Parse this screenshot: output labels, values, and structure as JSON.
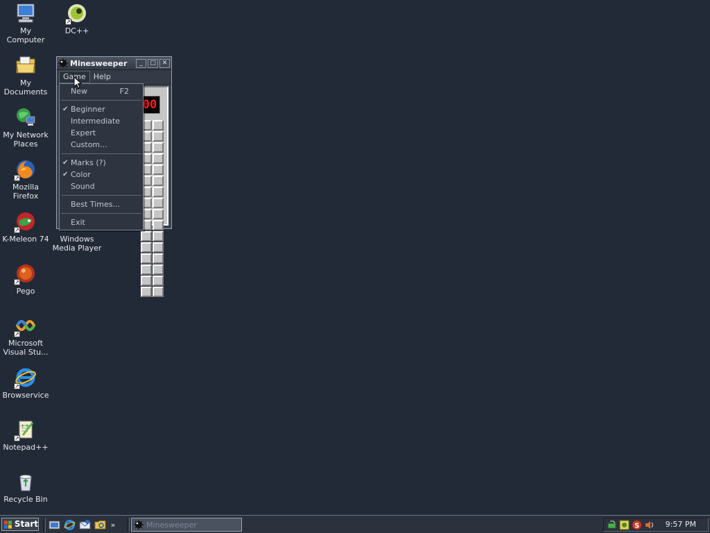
{
  "desktop": {
    "icons": [
      {
        "label": "My Computer",
        "icon": "my-computer-icon"
      },
      {
        "label": "My Documents",
        "icon": "my-documents-icon"
      },
      {
        "label": "My Network Places",
        "icon": "network-places-icon"
      },
      {
        "label": "Mozilla Firefox",
        "icon": "firefox-icon"
      },
      {
        "label": "K-Meleon 74",
        "icon": "k-meleon-icon"
      },
      {
        "label": "Pego",
        "icon": "pego-icon"
      },
      {
        "label": "Microsoft Visual Stu...",
        "icon": "visual-studio-icon"
      },
      {
        "label": "Browservice",
        "icon": "internet-explorer-icon"
      },
      {
        "label": "Notepad++",
        "icon": "notepad-plus-plus-icon"
      },
      {
        "label": "Recycle Bin",
        "icon": "recycle-bin-icon"
      },
      {
        "label": "DC++",
        "icon": "dcpp-icon"
      },
      {
        "label": "Windows Media Player",
        "icon": "media-player-icon"
      }
    ]
  },
  "window": {
    "title": "Minesweeper",
    "minimize": "_",
    "maximize": "□",
    "close": "✕",
    "menu": {
      "game": "Game",
      "help": "Help"
    },
    "mine_counter": "00"
  },
  "game_menu": {
    "items": [
      {
        "label": "New",
        "accel": "F2",
        "checked": false
      },
      {
        "label": "Beginner",
        "checked": true
      },
      {
        "label": "Intermediate",
        "checked": false
      },
      {
        "label": "Expert",
        "checked": false
      },
      {
        "label": "Custom...",
        "checked": false
      },
      {
        "label": "Marks (?)",
        "checked": true
      },
      {
        "label": "Color",
        "checked": true
      },
      {
        "label": "Sound",
        "checked": false
      },
      {
        "label": "Best Times...",
        "checked": false
      },
      {
        "label": "Exit",
        "checked": false
      }
    ],
    "check_glyph": "✔"
  },
  "taskbar": {
    "start": "Start",
    "quicklaunch_more": "»",
    "task": "Minesweeper",
    "clock": "9:57 PM"
  },
  "colors": {
    "desktop": "#232a37",
    "counter_digits": "#ff1b1b"
  }
}
